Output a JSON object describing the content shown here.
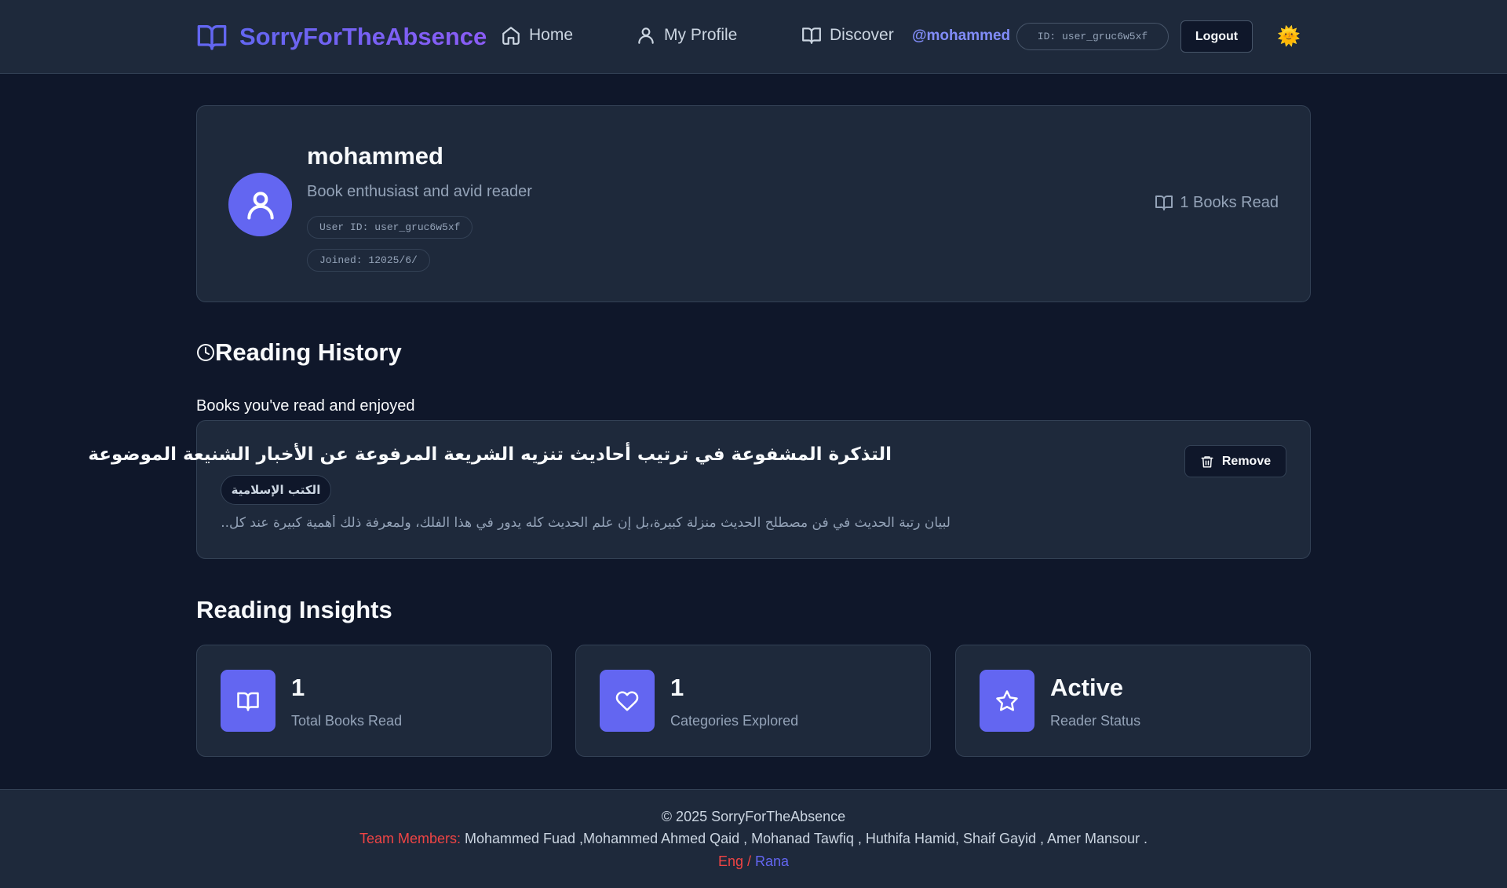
{
  "header": {
    "brand": "SorryForTheAbsence",
    "nav": [
      {
        "label": "Home",
        "icon": "home-icon"
      },
      {
        "label": "My Profile",
        "icon": "user-icon"
      },
      {
        "label": "Discover",
        "icon": "book-open-icon"
      }
    ],
    "username": "@mohammed",
    "id_pill": "ID: user_gruc6w5xf",
    "logout_label": "Logout",
    "theme_icon": "🌞"
  },
  "profile": {
    "name": "mohammed",
    "bio": "Book enthusiast and avid reader",
    "user_id": "User ID: user_gruc6w5xf",
    "joined": "Joined: 12025/6/",
    "books_read": "1 Books Read"
  },
  "history": {
    "title": "Reading History",
    "subtitle": "Books you've read and enjoyed",
    "items": [
      {
        "title": "التذكرة المشفوعة في ترتيب أحاديث تنزيه الشريعة المرفوعة عن الأخبار الشنيعة الموضوعة",
        "category": "الكتب الإسلامية",
        "description": "لبيان رتبة الحديث في فن مصطلح الحديث منزلة كبيرة،بل إن علم الحديث كله يدور في هذا الفلك، ولمعرفة ذلك أهمية كبيرة عند كل...",
        "remove_label": "Remove"
      }
    ]
  },
  "insights": {
    "title": "Reading Insights",
    "cards": [
      {
        "value": "1",
        "label": "Total Books Read",
        "icon": "book-open-icon"
      },
      {
        "value": "1",
        "label": "Categories Explored",
        "icon": "heart-icon"
      },
      {
        "value": "Active",
        "label": "Reader Status",
        "icon": "star-icon"
      }
    ]
  },
  "footer": {
    "copyright": "© 2025 SorryForTheAbsence",
    "team_label": "Team Members:",
    "team_names": " Mohammed Fuad ,Mohammed Ahmed Qaid , Mohanad Tawfiq , Huthifa Hamid, Shaif Gayid , Amer Mansour .",
    "eng": "Eng /",
    "eng_name": " Rana"
  },
  "colors": {
    "background": "#0f172a",
    "card": "#1e293b",
    "accent": "#6366f1",
    "footer_red": "#ef4444"
  }
}
